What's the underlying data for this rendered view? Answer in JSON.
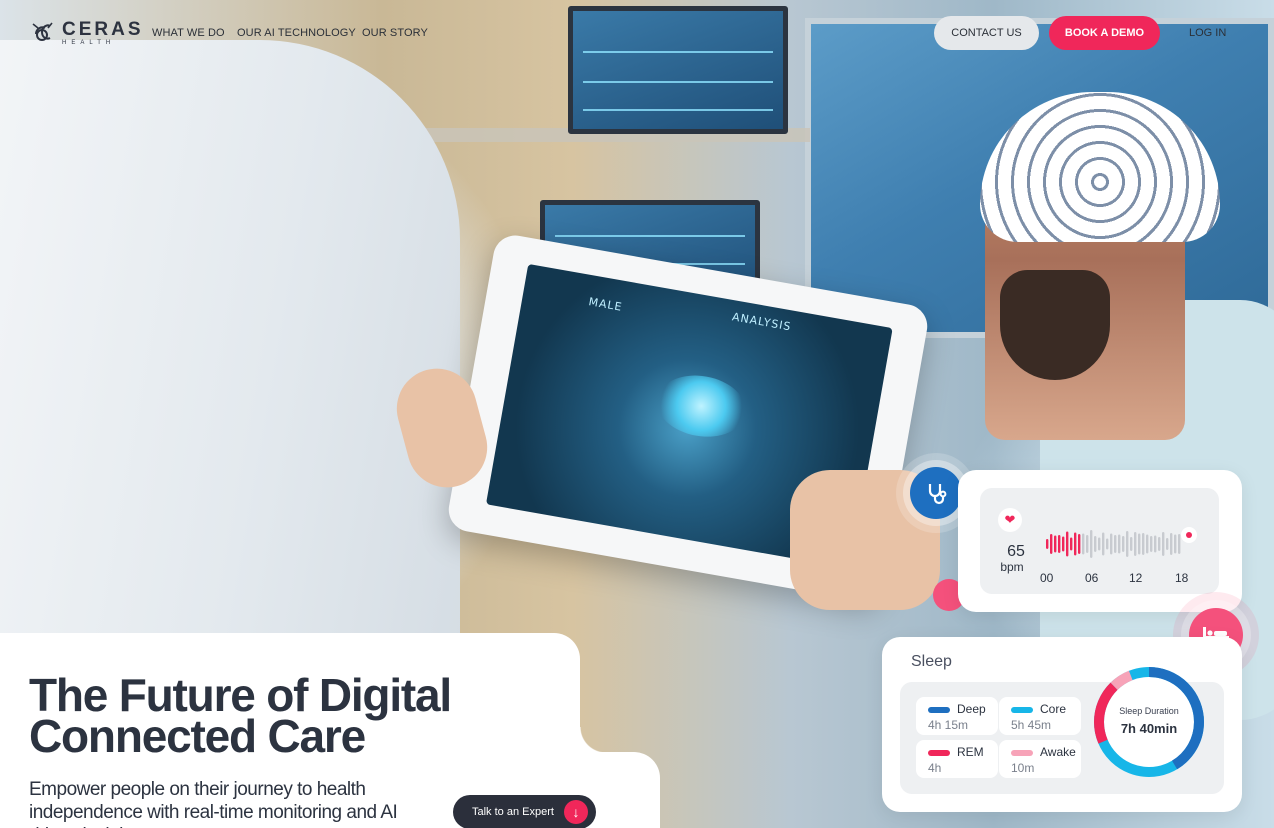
{
  "brand": {
    "name": "CERAS",
    "sub": "HEALTH",
    "logo_icon": "bee-logo-icon"
  },
  "nav": {
    "links": [
      "WHAT WE DO",
      "OUR AI TECHNOLOGY",
      "OUR STORY"
    ],
    "contact": "CONTACT US",
    "demo": "BOOK A DEMO",
    "login": "LOG IN"
  },
  "hero": {
    "headline_line1": "The Future of Digital",
    "headline_line2": "Connected Care",
    "subtext": "Empower people on their journey to health independence with real-time monitoring and AI driven insights.",
    "cta": "Talk to an Expert",
    "cta_icon": "arrow-down-icon"
  },
  "tablet": {
    "label_left": "MALE",
    "label_right": "ANALYSIS"
  },
  "heart_rate": {
    "value": "65",
    "unit": "bpm",
    "ticks": [
      "00",
      "06",
      "12",
      "18"
    ],
    "icon": "heart-icon"
  },
  "sleep": {
    "title": "Sleep",
    "stages": [
      {
        "name": "Deep",
        "value": "4h 15m",
        "color": "#1e6fc0"
      },
      {
        "name": "Core",
        "value": "5h 45m",
        "color": "#17b6e8"
      },
      {
        "name": "REM",
        "value": "4h",
        "color": "#f0275a"
      },
      {
        "name": "Awake",
        "value": "10m",
        "color": "#f7a3b8"
      }
    ],
    "duration_label": "Sleep Duration",
    "duration_value": "7h 40min"
  },
  "colors": {
    "accent": "#f0275a",
    "dark": "#2b2f3b",
    "blue": "#1e6fc0"
  },
  "icons": {
    "steth": "stethoscope-icon",
    "bed": "bed-icon"
  }
}
